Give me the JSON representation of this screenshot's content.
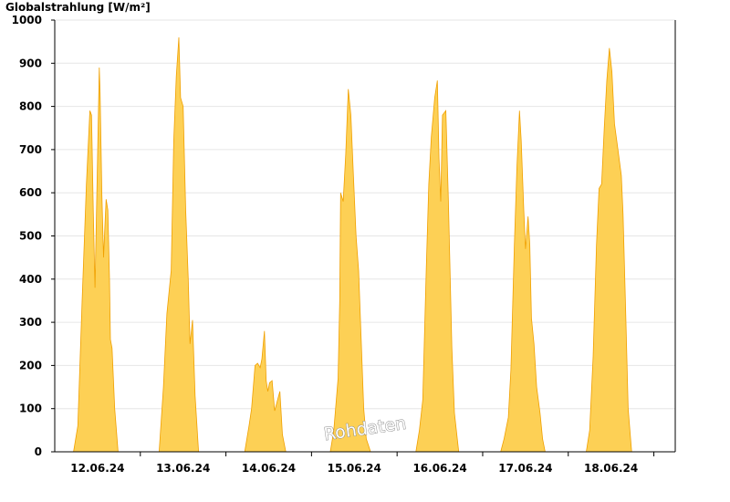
{
  "chart_data": {
    "type": "area",
    "title": "Globalstrahlung [W/m²]",
    "watermark": "Rohdaten",
    "y_ticks": [
      0,
      100,
      200,
      300,
      400,
      500,
      600,
      700,
      800,
      900,
      1000
    ],
    "ylim": [
      0,
      1000
    ],
    "xlim": [
      0,
      7.25
    ],
    "x_labels": [
      {
        "label": "12.06.24",
        "pos": 0.5
      },
      {
        "label": "13.06.24",
        "pos": 1.5
      },
      {
        "label": "14.06.24",
        "pos": 2.5
      },
      {
        "label": "15.06.24",
        "pos": 3.5
      },
      {
        "label": "16.06.24",
        "pos": 4.5
      },
      {
        "label": "17.06.24",
        "pos": 5.5
      },
      {
        "label": "18.06.24",
        "pos": 6.5
      }
    ],
    "x_day_boundaries": [
      1,
      2,
      3,
      4,
      5,
      6,
      7
    ],
    "grid": true,
    "fill_color": "#FDD055",
    "line_color": "#F0A000",
    "series": [
      {
        "points": [
          [
            0.22,
            0
          ],
          [
            0.27,
            60
          ],
          [
            0.32,
            350
          ],
          [
            0.37,
            620
          ],
          [
            0.41,
            790
          ],
          [
            0.43,
            780
          ],
          [
            0.45,
            560
          ],
          [
            0.47,
            380
          ],
          [
            0.5,
            680
          ],
          [
            0.52,
            890
          ],
          [
            0.53,
            830
          ],
          [
            0.55,
            600
          ],
          [
            0.57,
            450
          ],
          [
            0.59,
            540
          ],
          [
            0.6,
            585
          ],
          [
            0.62,
            560
          ],
          [
            0.64,
            400
          ],
          [
            0.65,
            260
          ],
          [
            0.67,
            240
          ],
          [
            0.7,
            100
          ],
          [
            0.74,
            0
          ]
        ]
      },
      {
        "points": [
          [
            1.22,
            0
          ],
          [
            1.27,
            150
          ],
          [
            1.31,
            320
          ],
          [
            1.36,
            420
          ],
          [
            1.39,
            720
          ],
          [
            1.42,
            870
          ],
          [
            1.45,
            960
          ],
          [
            1.47,
            820
          ],
          [
            1.5,
            800
          ],
          [
            1.53,
            560
          ],
          [
            1.56,
            400
          ],
          [
            1.58,
            250
          ],
          [
            1.61,
            305
          ],
          [
            1.64,
            130
          ],
          [
            1.68,
            0
          ]
        ]
      },
      {
        "points": [
          [
            2.22,
            0
          ],
          [
            2.27,
            60
          ],
          [
            2.3,
            100
          ],
          [
            2.34,
            200
          ],
          [
            2.37,
            205
          ],
          [
            2.4,
            195
          ],
          [
            2.42,
            215
          ],
          [
            2.45,
            280
          ],
          [
            2.47,
            165
          ],
          [
            2.49,
            140
          ],
          [
            2.51,
            160
          ],
          [
            2.54,
            165
          ],
          [
            2.57,
            95
          ],
          [
            2.61,
            125
          ],
          [
            2.63,
            140
          ],
          [
            2.66,
            40
          ],
          [
            2.7,
            0
          ]
        ]
      },
      {
        "points": [
          [
            3.22,
            0
          ],
          [
            3.26,
            50
          ],
          [
            3.31,
            170
          ],
          [
            3.33,
            350
          ],
          [
            3.34,
            600
          ],
          [
            3.37,
            580
          ],
          [
            3.4,
            690
          ],
          [
            3.43,
            840
          ],
          [
            3.46,
            780
          ],
          [
            3.49,
            640
          ],
          [
            3.52,
            500
          ],
          [
            3.55,
            420
          ],
          [
            3.58,
            260
          ],
          [
            3.61,
            100
          ],
          [
            3.64,
            30
          ],
          [
            3.69,
            0
          ]
        ]
      },
      {
        "points": [
          [
            4.22,
            0
          ],
          [
            4.26,
            50
          ],
          [
            4.3,
            120
          ],
          [
            4.34,
            420
          ],
          [
            4.37,
            620
          ],
          [
            4.4,
            730
          ],
          [
            4.44,
            820
          ],
          [
            4.47,
            860
          ],
          [
            4.49,
            680
          ],
          [
            4.51,
            580
          ],
          [
            4.53,
            780
          ],
          [
            4.57,
            790
          ],
          [
            4.6,
            580
          ],
          [
            4.64,
            240
          ],
          [
            4.67,
            90
          ],
          [
            4.72,
            0
          ]
        ]
      },
      {
        "points": [
          [
            5.21,
            0
          ],
          [
            5.25,
            30
          ],
          [
            5.3,
            80
          ],
          [
            5.33,
            190
          ],
          [
            5.37,
            480
          ],
          [
            5.4,
            660
          ],
          [
            5.43,
            790
          ],
          [
            5.45,
            720
          ],
          [
            5.48,
            560
          ],
          [
            5.5,
            470
          ],
          [
            5.53,
            545
          ],
          [
            5.55,
            480
          ],
          [
            5.57,
            310
          ],
          [
            5.6,
            250
          ],
          [
            5.63,
            150
          ],
          [
            5.67,
            90
          ],
          [
            5.7,
            30
          ],
          [
            5.73,
            0
          ]
        ]
      },
      {
        "points": [
          [
            6.21,
            0
          ],
          [
            6.25,
            50
          ],
          [
            6.29,
            220
          ],
          [
            6.33,
            480
          ],
          [
            6.36,
            610
          ],
          [
            6.39,
            620
          ],
          [
            6.42,
            750
          ],
          [
            6.45,
            860
          ],
          [
            6.48,
            935
          ],
          [
            6.51,
            880
          ],
          [
            6.54,
            760
          ],
          [
            6.58,
            700
          ],
          [
            6.62,
            640
          ],
          [
            6.64,
            550
          ],
          [
            6.67,
            330
          ],
          [
            6.7,
            100
          ],
          [
            6.74,
            0
          ]
        ]
      }
    ]
  }
}
